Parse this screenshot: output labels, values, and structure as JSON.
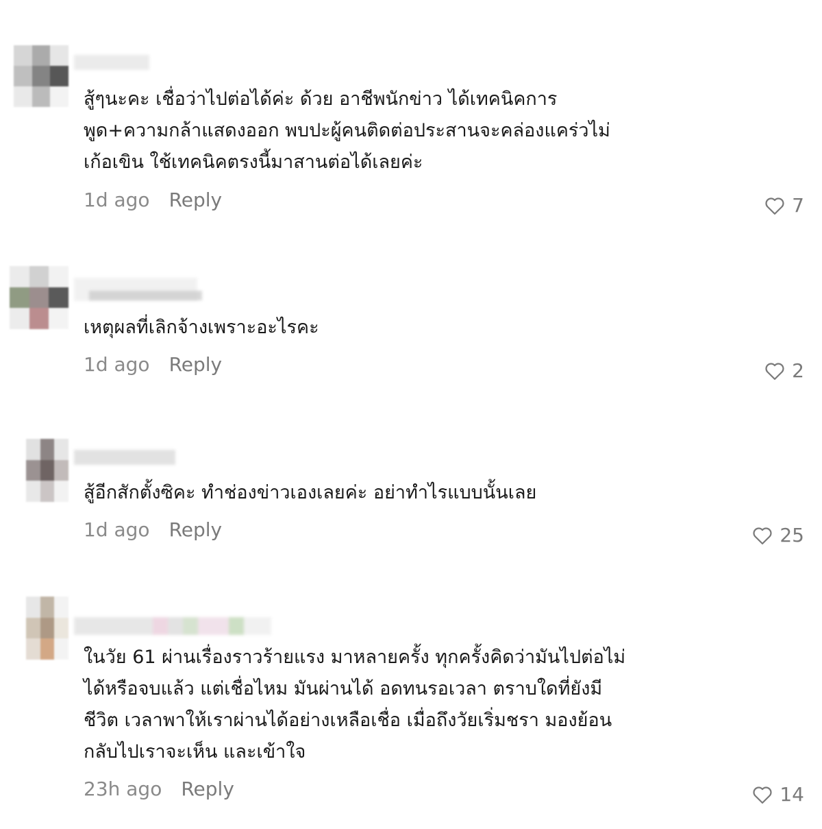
{
  "comments": [
    {
      "text": "สู้ๆนะคะ เชื่อว่าไปต่อได้ค่ะ ด้วย อาชีพนักข่าว ได้เทคนิคการ\nพูด+ความกล้าแสดงออก พบปะผู้คนติดต่อประสานจะคล่องแคร่วไม่\nเก้อเขิน ใช้เทคนิคตรงนี้มาสานต่อได้เลยค่ะ",
      "time": "1d ago",
      "reply_label": "Reply",
      "likes": "7"
    },
    {
      "text": "เหตุผลที่เลิกจ้างเพราะอะไรคะ",
      "time": "1d ago",
      "reply_label": "Reply",
      "likes": "2"
    },
    {
      "text": "สู้อีกสักตั้งซิคะ ทำช่องข่าวเองเลยค่ะ อย่าทำไรแบบนั้นเลย",
      "time": "1d ago",
      "reply_label": "Reply",
      "likes": "25"
    },
    {
      "text": "ในวัย 61 ผ่านเรื่องราวร้ายแรง มาหลายครั้ง ทุกครั้งคิดว่ามันไปต่อไม่\nได้หรือจบแล้ว แต่เชื่อไหม มันผ่านได้ อดทนรอเวลา ตราบใดที่ยังมี\nชีวิต เวลาพาให้เราผ่านได้อย่างเหลือเชื่อ เมื่อถึงวัยเริ่มชรา มองย้อน\nกลับไปเราจะเห็น และเข้าใจ",
      "time": "23h ago",
      "reply_label": "Reply",
      "likes": "14"
    }
  ],
  "colors": {
    "text": "#1a1a1a",
    "meta": "#8a8a8a",
    "heart": "#7a7a7a"
  },
  "icons": {
    "like": "heart-outline-icon"
  }
}
